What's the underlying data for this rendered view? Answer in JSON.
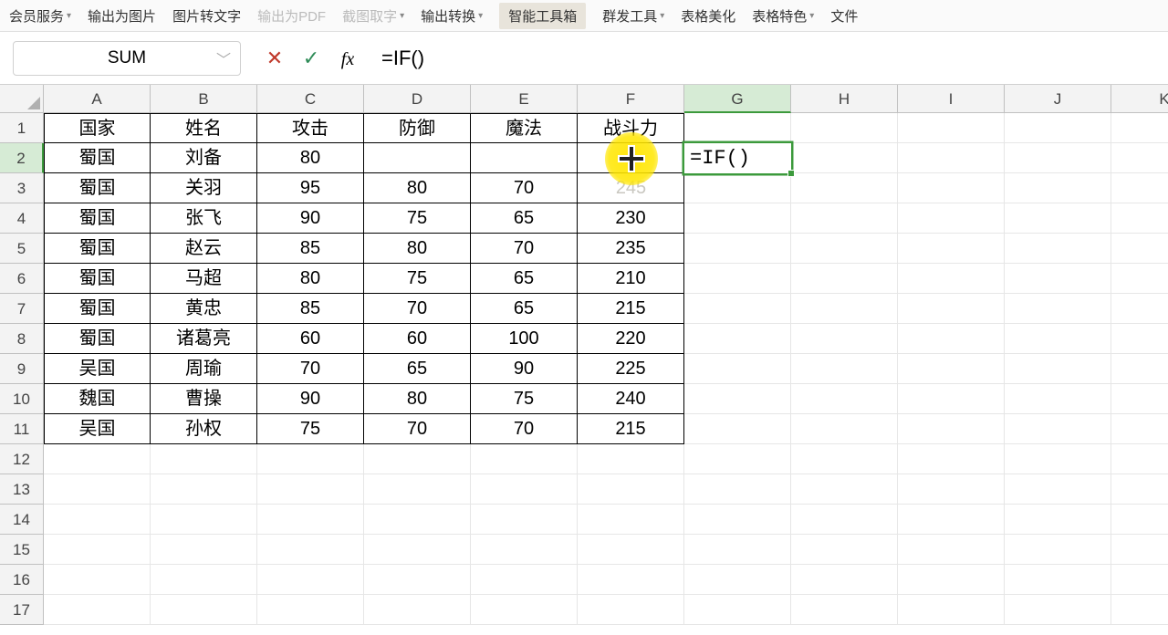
{
  "toolbar": {
    "items": [
      {
        "label": "会员服务",
        "dim": false,
        "dd": true
      },
      {
        "label": "输出为图片",
        "dim": false
      },
      {
        "label": "图片转文字",
        "dim": false
      },
      {
        "label": "输出为PDF",
        "dim": true
      },
      {
        "label": "截图取字",
        "dim": true,
        "dd": true
      },
      {
        "label": "输出转换",
        "dim": false,
        "dd": true
      }
    ],
    "highlight": "智能工具箱",
    "right": [
      {
        "label": "群发工具",
        "dd": true
      },
      {
        "label": "表格美化"
      },
      {
        "label": "表格特色",
        "dd": true
      },
      {
        "label": "文件",
        "cut": true
      }
    ]
  },
  "name_box": "SUM",
  "formula": "=IF()",
  "cell_edit": "=IF()",
  "columns": [
    "A",
    "B",
    "C",
    "D",
    "E",
    "F",
    "G",
    "H",
    "I",
    "J",
    "K"
  ],
  "row_count": 17,
  "active_col": "G",
  "active_row": 2,
  "headers": [
    "国家",
    "姓名",
    "攻击",
    "防御",
    "魔法",
    "战斗力"
  ],
  "f2_hidden_under_cursor": "245",
  "chart_data": {
    "type": "table",
    "columns": [
      "国家",
      "姓名",
      "攻击",
      "防御",
      "魔法",
      "战斗力"
    ],
    "rows": [
      [
        "蜀国",
        "刘备",
        "80",
        "",
        "",
        "",
        ""
      ],
      [
        "蜀国",
        "关羽",
        "95",
        "80",
        "70",
        "245"
      ],
      [
        "蜀国",
        "张飞",
        "90",
        "75",
        "65",
        "230"
      ],
      [
        "蜀国",
        "赵云",
        "85",
        "80",
        "70",
        "235"
      ],
      [
        "蜀国",
        "马超",
        "80",
        "75",
        "65",
        "210"
      ],
      [
        "蜀国",
        "黄忠",
        "85",
        "70",
        "65",
        "215"
      ],
      [
        "蜀国",
        "诸葛亮",
        "60",
        "60",
        "100",
        "220"
      ],
      [
        "吴国",
        "周瑜",
        "70",
        "65",
        "90",
        "225"
      ],
      [
        "魏国",
        "曹操",
        "90",
        "80",
        "75",
        "240"
      ],
      [
        "吴国",
        "孙权",
        "75",
        "70",
        "70",
        "215"
      ]
    ]
  }
}
